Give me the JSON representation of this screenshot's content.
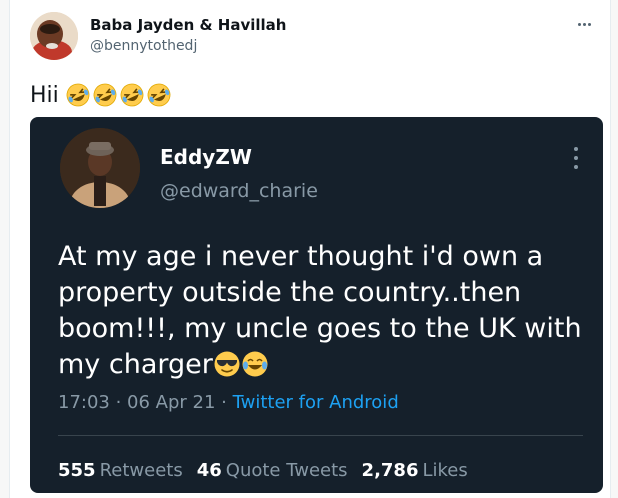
{
  "tweet": {
    "author_name": "Baba Jayden & Havillah",
    "author_handle": "@bennytothedj",
    "text": "Hii",
    "emojis": [
      "rofl-emoji",
      "rofl-emoji",
      "rofl-emoji",
      "rofl-emoji"
    ],
    "more_icon": "more-horizontal-icon"
  },
  "embedded": {
    "name": "EddyZW",
    "handle": "@edward_charie",
    "text": "At my age i never thought i'd own a property outside the country..then boom!!!, my uncle goes to the UK with my charger",
    "trailing_emojis": [
      "sunglasses-emoji",
      "tears-of-joy-emoji"
    ],
    "time": "17:03",
    "separator": " · ",
    "date": "06 Apr 21",
    "source": "Twitter for Android",
    "stats": {
      "retweets_count": "555",
      "retweets_label": "Retweets",
      "quotes_count": "46",
      "quotes_label": "Quote Tweets",
      "likes_count": "2,786",
      "likes_label": "Likes"
    },
    "more_icon": "more-vertical-icon"
  },
  "colors": {
    "dark_bg": "#15202b",
    "muted": "#8899a6",
    "link": "#1da1f2",
    "emoji_yellow": "#ffcc4d"
  }
}
